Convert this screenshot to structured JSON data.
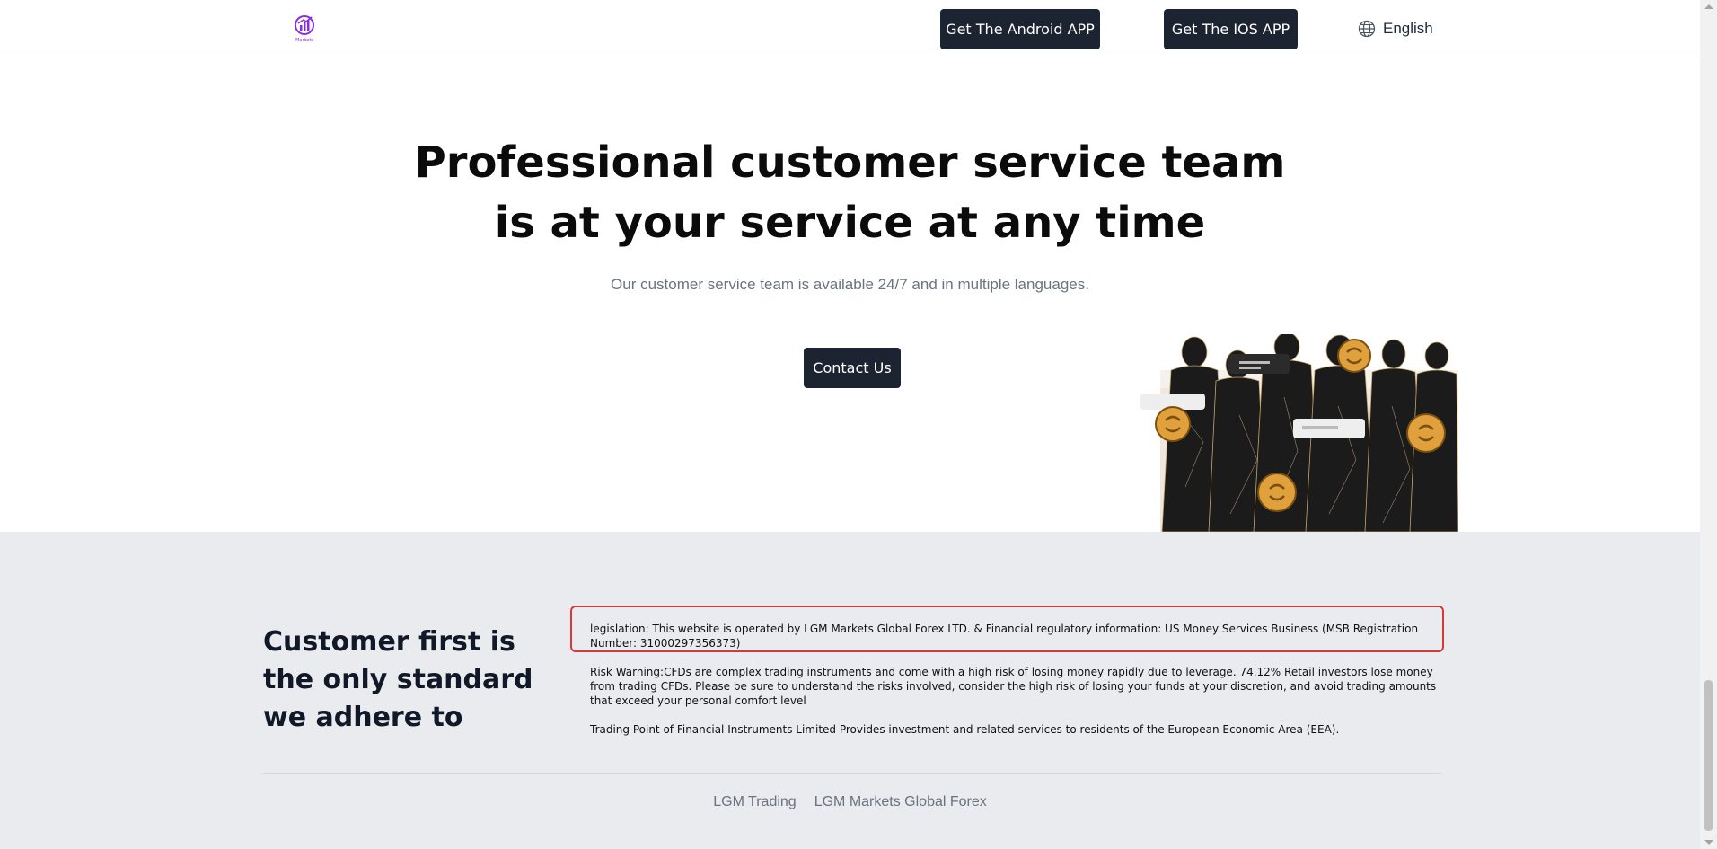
{
  "header": {
    "logo_label": "Markets",
    "android_button": "Get The Android APP",
    "ios_button": "Get The IOS APP",
    "language": "English"
  },
  "hero": {
    "title_line1": "Professional customer service team",
    "title_line2": "is at your service at any time",
    "subtitle": "Our customer service team is available 24/7 and in multiple languages.",
    "contact_button": "Contact Us"
  },
  "footer": {
    "title": "Customer first is the only standard we adhere to",
    "legislation": "legislation:  This website is operated by LGM Markets Global Forex LTD. & Financial regulatory information: US Money Services Business (MSB Registration Number: 31000297356373)",
    "risk_warning": "Risk Warning:CFDs are complex trading instruments and come with a high risk of losing money rapidly due to leverage. 74.12% Retail investors lose money from trading CFDs. Please be sure to understand the risks involved, consider the high risk of losing your funds at your discretion, and avoid trading amounts that exceed your personal comfort level",
    "eea_notice": "Trading Point of Financial Instruments Limited Provides investment and related services to residents of the European Economic Area (EEA).",
    "links": [
      "LGM Trading",
      "LGM Markets Global Forex"
    ]
  },
  "colors": {
    "dark_button": "#1c2431",
    "footer_bg": "#e9ebef",
    "highlight_border": "#d43a3a",
    "logo_purple": "#8a2be2"
  },
  "icons": {
    "globe": "globe-icon",
    "logo": "markets-logo"
  }
}
